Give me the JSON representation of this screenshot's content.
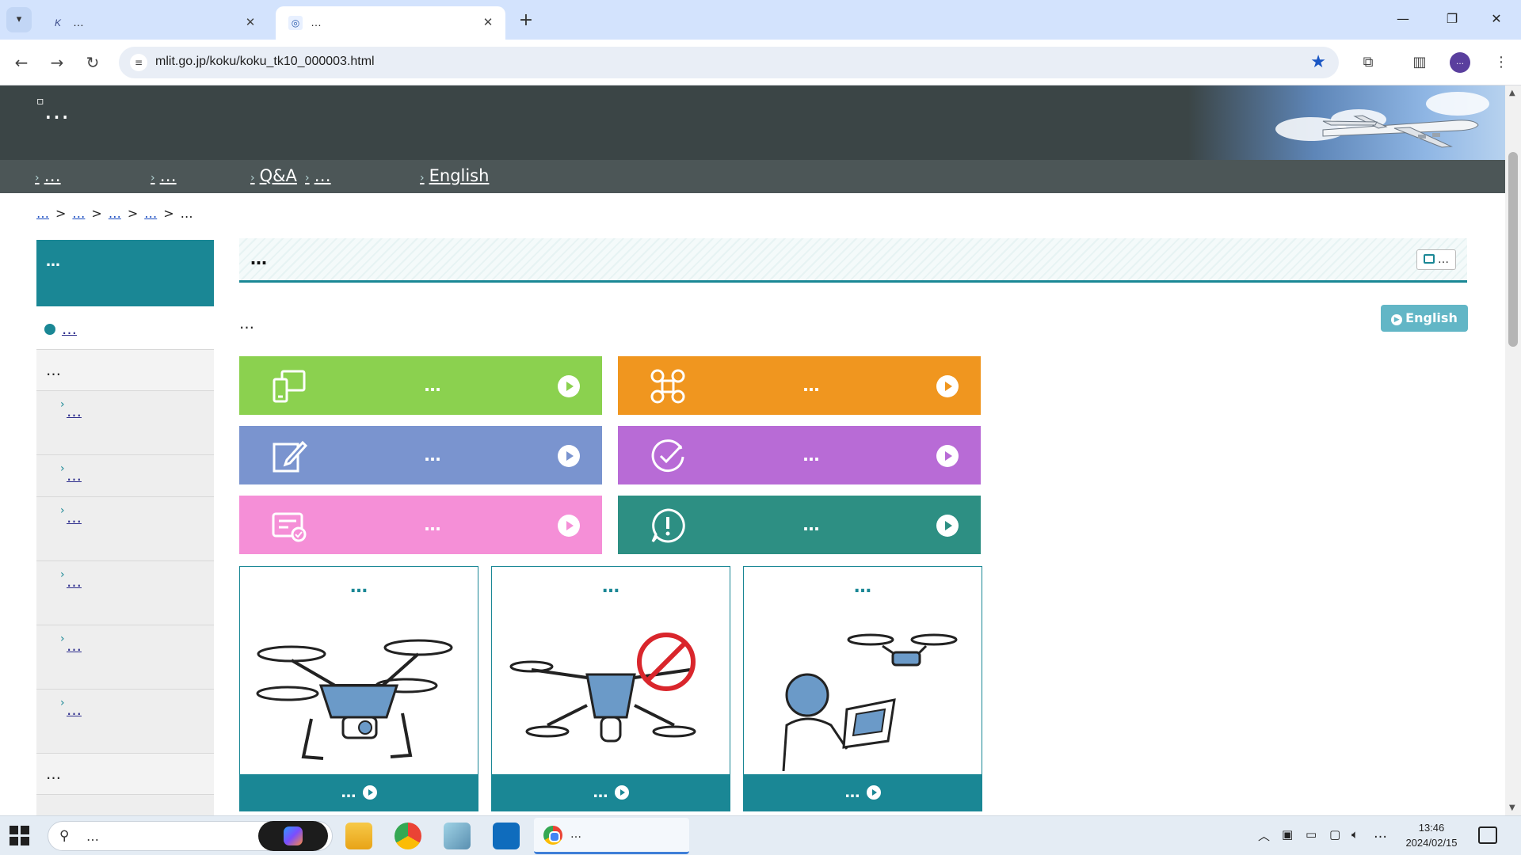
{
  "browser": {
    "tabs": [
      {
        "title": "…",
        "active": false
      },
      {
        "title": "…",
        "active": true
      }
    ],
    "url": "mlit.go.jp/koku/koku_tk10_000003.html",
    "profile_initials": "…"
  },
  "site": {
    "logo_text": "…",
    "nav": [
      "…",
      "…",
      "Q&A",
      "…",
      "English"
    ]
  },
  "breadcrumb": [
    "…",
    "…",
    "…",
    "…",
    "…"
  ],
  "sidebar": {
    "title": "…",
    "items": [
      {
        "kind": "top",
        "label": "…"
      },
      {
        "kind": "cat",
        "label": "…"
      },
      {
        "kind": "sub",
        "label": "…"
      },
      {
        "kind": "sub",
        "label": "…"
      },
      {
        "kind": "sub",
        "label": "…"
      },
      {
        "kind": "sub",
        "label": "…"
      },
      {
        "kind": "sub",
        "label": "…"
      },
      {
        "kind": "sub",
        "label": "…"
      },
      {
        "kind": "cat",
        "label": "…"
      }
    ]
  },
  "main": {
    "title": "…",
    "print_label": "…",
    "english_label": "English",
    "intro": "…",
    "category_buttons": [
      {
        "label": "…",
        "color": "#8bd14f",
        "icon": "phone-screen-icon"
      },
      {
        "label": "…",
        "color": "#f0961f",
        "icon": "drone-icon"
      },
      {
        "label": "…",
        "color": "#7a94cf",
        "icon": "edit-form-icon"
      },
      {
        "label": "…",
        "color": "#b86bd6",
        "icon": "check-circle-icon"
      },
      {
        "label": "…",
        "color": "#f58fd7",
        "icon": "certificate-icon"
      },
      {
        "label": "…",
        "color": "#2d8f83",
        "icon": "alert-bubble-icon"
      }
    ],
    "cards": [
      {
        "title": "…",
        "footer": "…",
        "image": "drone-illustration-icon"
      },
      {
        "title": "…",
        "footer": "…",
        "image": "prohibited-drone-icon"
      },
      {
        "title": "…",
        "footer": "…",
        "image": "pilot-controller-icon"
      }
    ],
    "accent_color": "#1a8795"
  },
  "taskbar": {
    "search_placeholder": "…",
    "active_window": "…",
    "ime_indicator": "…",
    "time": "13:46",
    "date": "2024/02/15"
  }
}
